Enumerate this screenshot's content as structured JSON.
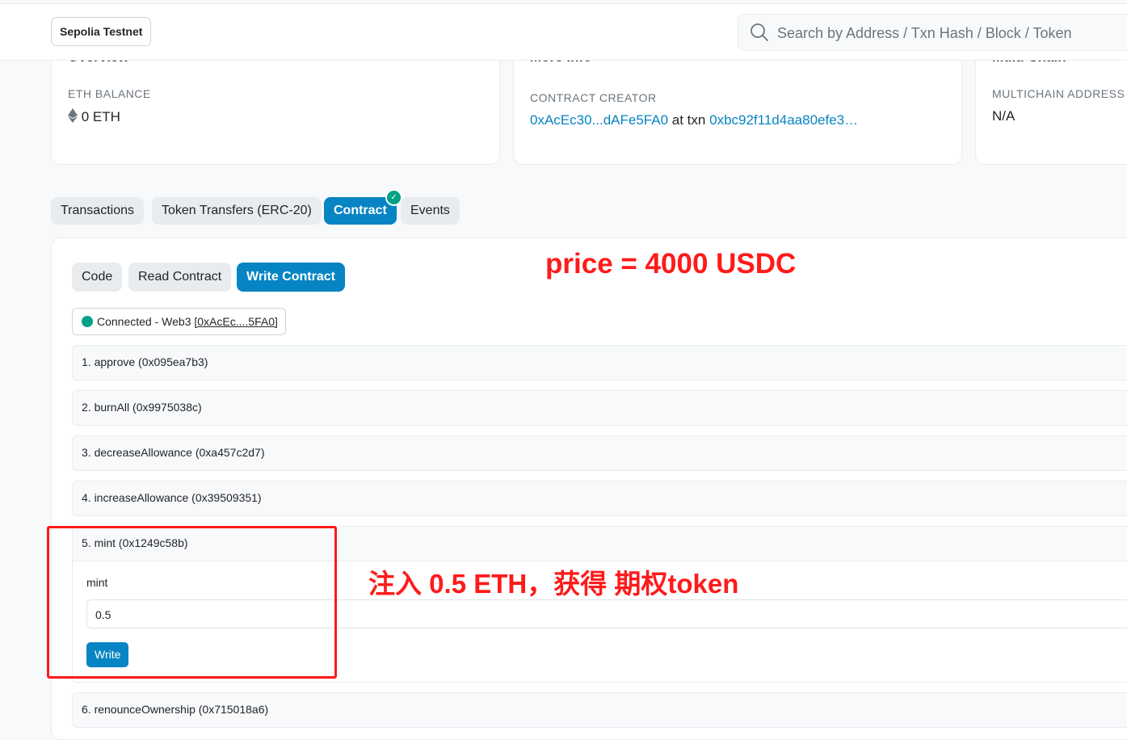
{
  "header": {
    "network_badge": "Sepolia Testnet",
    "search_placeholder": "Search by Address / Txn Hash / Block / Token"
  },
  "cards": {
    "overview": {
      "title": "Overview",
      "label": "ETH BALANCE",
      "value": "0 ETH"
    },
    "more_info": {
      "title": "More Info",
      "label": "CONTRACT CREATOR",
      "creator": "0xAcEc30...dAFe5FA0",
      "at_txn": "at txn",
      "txn": "0xbc92f11d4aa80efe3…"
    },
    "multichain": {
      "title": "Multi Chain",
      "label": "MULTICHAIN ADDRESS",
      "value": "N/A"
    }
  },
  "tabs": [
    {
      "label": "Transactions"
    },
    {
      "label": "Token Transfers (ERC-20)"
    },
    {
      "label": "Contract"
    },
    {
      "label": "Events"
    }
  ],
  "subtabs": [
    {
      "label": "Code"
    },
    {
      "label": "Read Contract"
    },
    {
      "label": "Write Contract"
    }
  ],
  "connection": {
    "prefix": "Connected - Web3",
    "address": "[0xAcEc....5FA0]"
  },
  "functions": [
    "1. approve (0x095ea7b3)",
    "2. burnAll (0x9975038c)",
    "3. decreaseAllowance (0xa457c2d7)",
    "4. increaseAllowance (0x39509351)",
    "5. mint (0x1249c58b)",
    "6. renounceOwnership (0x715018a6)"
  ],
  "mint_form": {
    "param_label": "mint",
    "value": "0.5",
    "button": "Write"
  },
  "annotations": {
    "price": "price = 4000 USDC",
    "mint_note": "注入 0.5 ETH，获得 期权token",
    "color": "#ff1a1a"
  },
  "colors": {
    "primary": "#0784c3",
    "success": "#00a186"
  }
}
